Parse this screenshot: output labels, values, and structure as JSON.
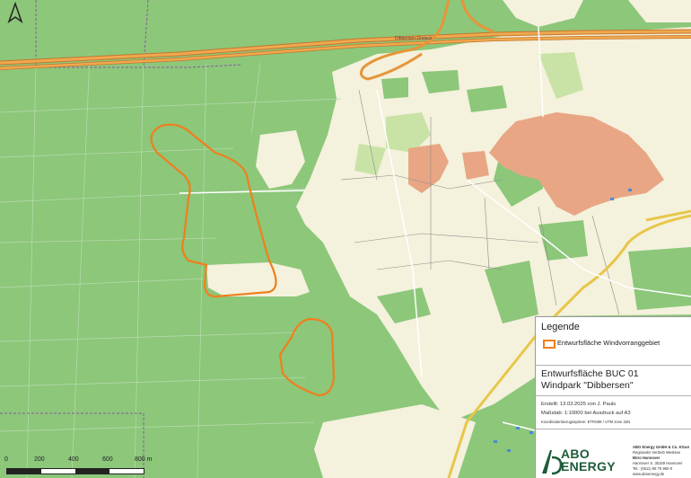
{
  "map": {
    "scale_labels": [
      "0",
      "200",
      "400",
      "600",
      "800 m"
    ],
    "place_label": "Dibbersen-Dreieck",
    "colors": {
      "forest": "#8cc77a",
      "open_land": "#f4f1dc",
      "meadow": "#c9e3a7",
      "settlement": "#e8a684",
      "motorway": "#e6953a",
      "boundary": "#8a5aa0",
      "outline": "#f07f1d"
    }
  },
  "legend": {
    "title": "Legende",
    "item": "Entwurfsfläche Windvorranggebiet"
  },
  "project": {
    "title": "Entwurfsfläche BUC 01",
    "subtitle": "Windpark \"Dibbersen\"",
    "created": "Erstellt: 13.03.2025 von J. Pauls",
    "scale": "Maßstab: 1:10000 bei Ausdruck auf A3",
    "crs": "Koordinatenbezugssystem: ETRS89 / UTM zone 32N"
  },
  "company": {
    "logo_line1": "ABO",
    "logo_line2": "ENERGY",
    "name": "ABO Energy GmbH & Co. KGaA",
    "line2": "Regionaler Vertrieb Westsee",
    "line3": "Büro Hannover",
    "line4": "Hannover S. 30159 Hannover",
    "line5": "Tel.: (0511) 95 75 960-0",
    "line6": "www.aboenergy.de"
  }
}
